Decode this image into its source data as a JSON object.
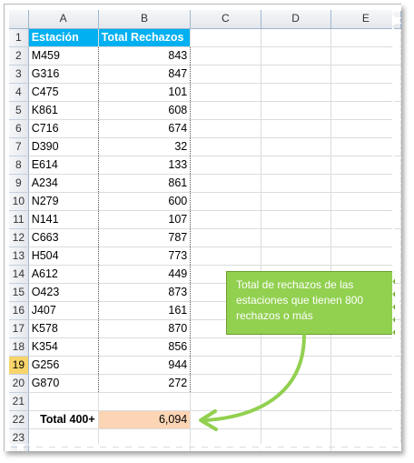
{
  "columns": [
    "A",
    "B",
    "C",
    "D",
    "E"
  ],
  "headers": {
    "station": "Estación",
    "rejections": "Total Rechazos"
  },
  "rows": [
    {
      "n": "1"
    },
    {
      "n": "2",
      "station": "M459",
      "value": "843"
    },
    {
      "n": "3",
      "station": "G316",
      "value": "847"
    },
    {
      "n": "4",
      "station": "C475",
      "value": "101"
    },
    {
      "n": "5",
      "station": "K861",
      "value": "608"
    },
    {
      "n": "6",
      "station": "C716",
      "value": "674"
    },
    {
      "n": "7",
      "station": "D390",
      "value": "32"
    },
    {
      "n": "8",
      "station": "E614",
      "value": "133"
    },
    {
      "n": "9",
      "station": "A234",
      "value": "861"
    },
    {
      "n": "10",
      "station": "N279",
      "value": "600"
    },
    {
      "n": "11",
      "station": "N141",
      "value": "107"
    },
    {
      "n": "12",
      "station": "C663",
      "value": "787"
    },
    {
      "n": "13",
      "station": "H504",
      "value": "773"
    },
    {
      "n": "14",
      "station": "A612",
      "value": "449"
    },
    {
      "n": "15",
      "station": "O423",
      "value": "873"
    },
    {
      "n": "16",
      "station": "J407",
      "value": "161"
    },
    {
      "n": "17",
      "station": "K578",
      "value": "870"
    },
    {
      "n": "18",
      "station": "K354",
      "value": "856"
    },
    {
      "n": "19",
      "station": "G256",
      "value": "944"
    },
    {
      "n": "20",
      "station": "G870",
      "value": "272"
    },
    {
      "n": "21"
    },
    {
      "n": "22"
    },
    {
      "n": "23"
    },
    {
      "n": "24"
    }
  ],
  "total": {
    "label": "Total 400+",
    "value": "6,094"
  },
  "callout": {
    "text": "Total de rechazos de las estaciones que tienen 800 rechazos o más"
  },
  "colors": {
    "header_fill": "#00b0f0",
    "total_fill": "#fcd5b4",
    "callout_fill": "#92d050",
    "active_row": "#f8d56a"
  }
}
